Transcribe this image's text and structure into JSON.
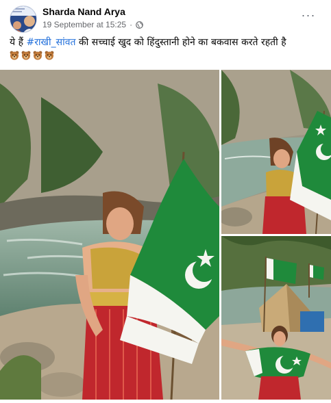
{
  "post": {
    "author": "Sharda Nand Arya",
    "timestamp": "19 September at 15:25",
    "separator": "·",
    "more_label": "···",
    "caption_pre": "ये हैं ",
    "hashtag": "#राखी_सांवत",
    "caption_post": " की सच्चाई खुद को हिंदुस्तानी होने का बकवास करते रहती है",
    "emoji_count": 4,
    "emoji_name": "bear-face-icon",
    "privacy_icon": "globe-icon"
  },
  "colors": {
    "link": "#216fdb",
    "meta": "#65676b",
    "flag_green": "#1f8a3b",
    "flag_white": "#f5f5f0"
  },
  "photos": [
    {
      "name": "photo-main",
      "alt": "woman holding flag by river"
    },
    {
      "name": "photo-top-right",
      "alt": "woman holding flag by river"
    },
    {
      "name": "photo-bottom-right",
      "alt": "woman wrapped in flag near tent"
    }
  ]
}
